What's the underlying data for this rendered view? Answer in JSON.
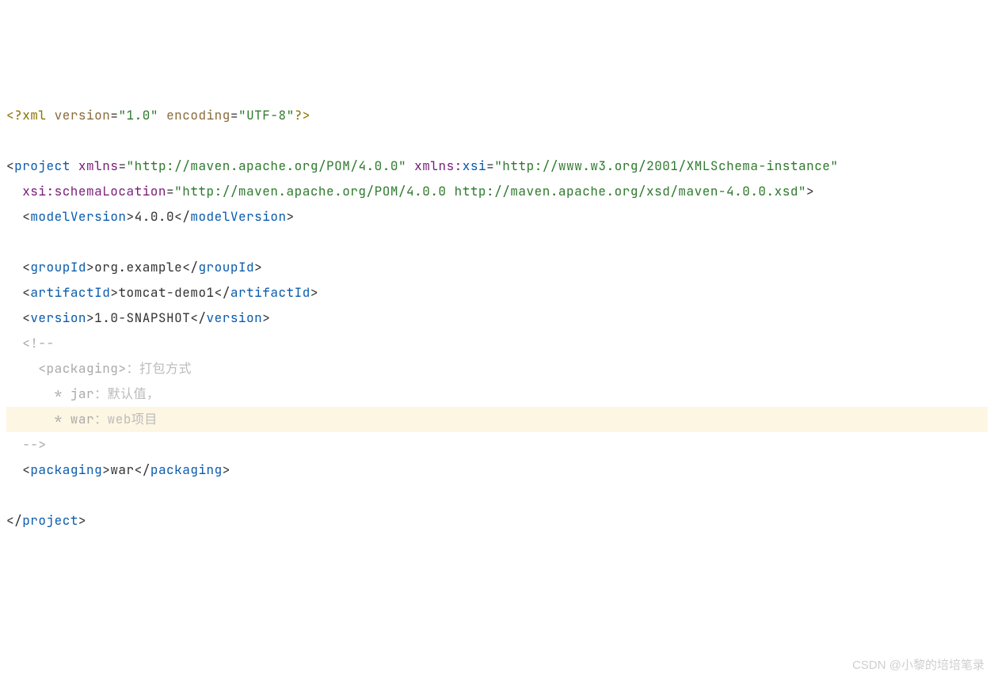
{
  "code": {
    "xml_decl": {
      "open": "<?",
      "name": "xml",
      "attr1_name": "version",
      "attr1_val": "\"1.0\"",
      "attr2_name": "encoding",
      "attr2_val": "\"UTF-8\"",
      "close": "?>"
    },
    "project_open": {
      "lt": "<",
      "name": "project",
      "xmlns_name": "xmlns",
      "xmlns_val": "\"http://maven.apache.org/POM/4.0.0\"",
      "xmlns_xsi_prefix": "xmlns:",
      "xmlns_xsi_local": "xsi",
      "xmlns_xsi_val": "\"http://www.w3.org/2001/XMLSchema-instance\"",
      "schema_prefix": "xsi:",
      "schema_local": "schemaLocation",
      "schema_val": "\"http://maven.apache.org/POM/4.0.0 http://maven.apache.org/xsd/maven-4.0.0.xsd\"",
      "gt": ">"
    },
    "modelVersion": {
      "tag": "modelVersion",
      "val": "4.0.0"
    },
    "groupId": {
      "tag": "groupId",
      "val": "org.example"
    },
    "artifactId": {
      "tag": "artifactId",
      "val": "tomcat-demo1"
    },
    "version": {
      "tag": "version",
      "val": "1.0-SNAPSHOT"
    },
    "comment": {
      "open": "<!--",
      "l1a": "<packaging>",
      "l1b": "：打包方式",
      "l2a": "* jar",
      "l2b": "：默认值，",
      "l3a": "* war",
      "l3b": "：web项目",
      "close": "-->"
    },
    "packaging": {
      "tag": "packaging",
      "val": "war"
    },
    "project_close": {
      "name": "project"
    },
    "angle": {
      "lt": "<",
      "lts": "</",
      "gt": ">",
      "eq": "="
    }
  },
  "watermark": "CSDN @小黎的培培笔录"
}
